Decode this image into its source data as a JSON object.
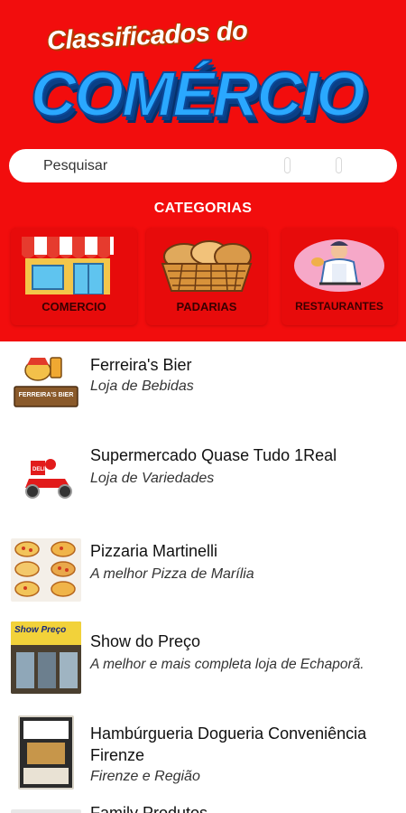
{
  "header": {
    "logo": {
      "line1": "Classificados do",
      "line2": "COMÉRCIO"
    },
    "search": {
      "placeholder": "Pesquisar"
    },
    "categories_title": "CATEGORIAS",
    "categories": [
      {
        "label": "COMERCIO",
        "icon": "storefront-icon"
      },
      {
        "label": "PADARIAS",
        "icon": "bread-basket-icon"
      },
      {
        "label": "RESTAURANTES",
        "icon": "chef-icon"
      }
    ],
    "colors": {
      "header_bg": "#f20d0d",
      "card_bg": "#e70b0b"
    }
  },
  "listings": [
    {
      "title": "Ferreira's Bier",
      "subtitle": "Loja de Bebidas",
      "thumb_text": "FERREIRA'S BIER",
      "icon": "beer-mascot-icon"
    },
    {
      "title": "Supermercado Quase Tudo 1Real",
      "subtitle": "Loja de Variedades",
      "icon": "delivery-scooter-icon"
    },
    {
      "title": "Pizzaria Martinelli",
      "subtitle": "A melhor Pizza de Marília",
      "icon": "pizzas-icon"
    },
    {
      "title": "Show do Preço",
      "subtitle": "A melhor e mais completa loja de Echaporã.",
      "thumb_text": "Show Preço",
      "icon": "storefront-photo-icon"
    },
    {
      "title": "Hambúrgueria Dogueria Conveniência Firenze",
      "subtitle": " Firenze e Região",
      "icon": "burger-menu-photo-icon"
    },
    {
      "title": "Family Produtos",
      "subtitle": "",
      "icon": "store-icon"
    }
  ]
}
